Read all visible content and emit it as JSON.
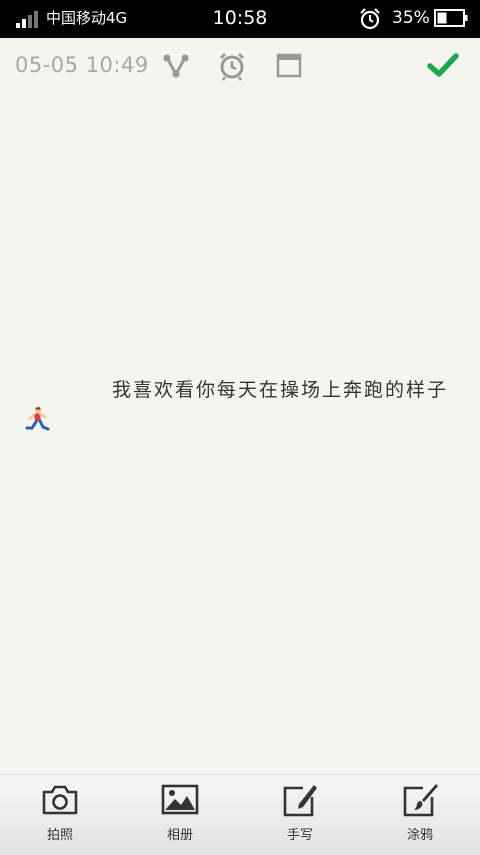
{
  "status_bar": {
    "carrier": "中国移动4G",
    "time": "10:58",
    "battery": "35%",
    "icons": [
      "signal-icon",
      "alarm-icon",
      "battery-icon"
    ]
  },
  "toolbar": {
    "datetime": "05-05 10:49",
    "icons": [
      "share-icon",
      "alarm-icon",
      "window-icon",
      "check-icon"
    ],
    "accent_color": "#1fa64b"
  },
  "note": {
    "text": "我喜欢看你每天在操场上奔跑的样子",
    "emoji": "runner-icon"
  },
  "bottom_bar": {
    "items": [
      {
        "label": "拍照",
        "icon": "camera-icon"
      },
      {
        "label": "相册",
        "icon": "gallery-icon"
      },
      {
        "label": "手写",
        "icon": "handwrite-icon"
      },
      {
        "label": "涂鸦",
        "icon": "doodle-icon"
      }
    ]
  }
}
